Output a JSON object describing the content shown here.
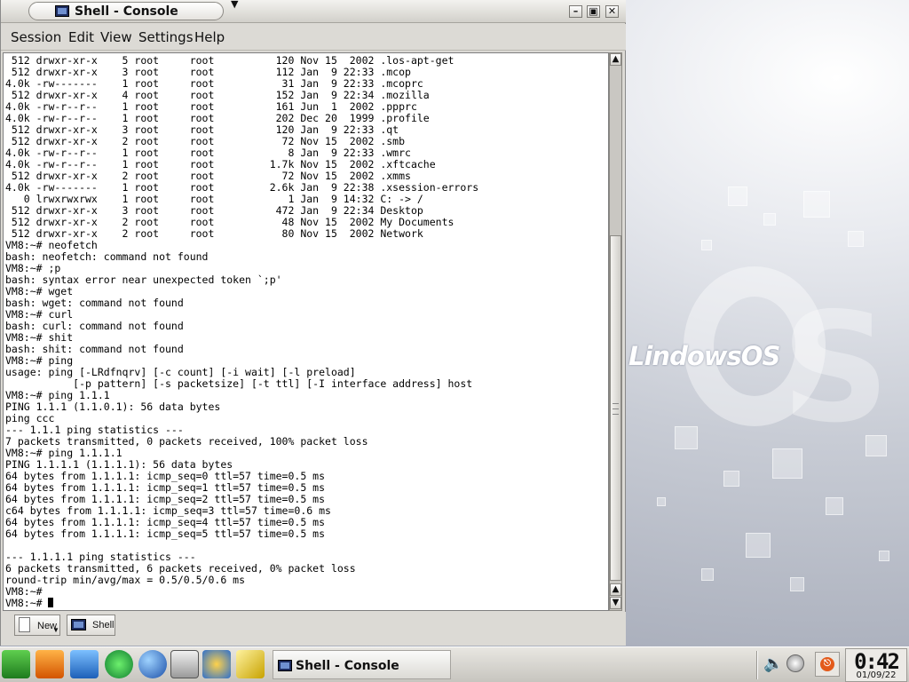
{
  "window": {
    "title": "Shell - Console"
  },
  "menubar": {
    "items": [
      "Session",
      "Edit",
      "View",
      "Settings",
      "Help"
    ]
  },
  "terminal": {
    "lines": [
      " 512 drwxr-xr-x    5 root     root          120 Nov 15  2002 .los-apt-get",
      " 512 drwxr-xr-x    3 root     root          112 Jan  9 22:33 .mcop",
      "4.0k -rw-------    1 root     root           31 Jan  9 22:33 .mcoprc",
      " 512 drwxr-xr-x    4 root     root          152 Jan  9 22:34 .mozilla",
      "4.0k -rw-r--r--    1 root     root          161 Jun  1  2002 .ppprc",
      "4.0k -rw-r--r--    1 root     root          202 Dec 20  1999 .profile",
      " 512 drwxr-xr-x    3 root     root          120 Jan  9 22:33 .qt",
      " 512 drwxr-xr-x    2 root     root           72 Nov 15  2002 .smb",
      "4.0k -rw-r--r--    1 root     root            8 Jan  9 22:33 .wmrc",
      "4.0k -rw-r--r--    1 root     root         1.7k Nov 15  2002 .xftcache",
      " 512 drwxr-xr-x    2 root     root           72 Nov 15  2002 .xmms",
      "4.0k -rw-------    1 root     root         2.6k Jan  9 22:38 .xsession-errors",
      "   0 lrwxrwxrwx    1 root     root            1 Jan  9 14:32 C: -> /",
      " 512 drwxr-xr-x    3 root     root          472 Jan  9 22:34 Desktop",
      " 512 drwxr-xr-x    2 root     root           48 Nov 15  2002 My Documents",
      " 512 drwxr-xr-x    2 root     root           80 Nov 15  2002 Network",
      "VM8:~# neofetch",
      "bash: neofetch: command not found",
      "VM8:~# ;p",
      "bash: syntax error near unexpected token `;p'",
      "VM8:~# wget",
      "bash: wget: command not found",
      "VM8:~# curl",
      "bash: curl: command not found",
      "VM8:~# shit",
      "bash: shit: command not found",
      "VM8:~# ping",
      "usage: ping [-LRdfnqrv] [-c count] [-i wait] [-l preload]",
      "           [-p pattern] [-s packetsize] [-t ttl] [-I interface address] host",
      "VM8:~# ping 1.1.1",
      "PING 1.1.1 (1.1.0.1): 56 data bytes",
      "ping ccc",
      "--- 1.1.1 ping statistics ---",
      "7 packets transmitted, 0 packets received, 100% packet loss",
      "VM8:~# ping 1.1.1.1",
      "PING 1.1.1.1 (1.1.1.1): 56 data bytes",
      "64 bytes from 1.1.1.1: icmp_seq=0 ttl=57 time=0.5 ms",
      "64 bytes from 1.1.1.1: icmp_seq=1 ttl=57 time=0.5 ms",
      "64 bytes from 1.1.1.1: icmp_seq=2 ttl=57 time=0.5 ms",
      "c64 bytes from 1.1.1.1: icmp_seq=3 ttl=57 time=0.6 ms",
      "64 bytes from 1.1.1.1: icmp_seq=4 ttl=57 time=0.5 ms",
      "64 bytes from 1.1.1.1: icmp_seq=5 ttl=57 time=0.5 ms",
      "",
      "--- 1.1.1.1 ping statistics ---",
      "6 packets transmitted, 6 packets received, 0% packet loss",
      "round-trip min/avg/max = 0.5/0.5/0.6 ms",
      "VM8:~#"
    ],
    "prompt": "VM8:~# "
  },
  "tabs": {
    "new_label": "New",
    "shell_label": "Shell"
  },
  "desktop": {
    "logo": "LindowsOS"
  },
  "panel": {
    "launchers": [
      "lindows-start-icon",
      "safety-icon",
      "box-icon",
      "runner-icon",
      "globe-icon",
      "terminal-icon",
      "click-n-run-icon",
      "office-icon"
    ],
    "task_label": "Shell - Console",
    "clock_time": "0:42",
    "clock_date": "01/09/22"
  },
  "colors": {
    "terminal_bg": "#ffffff",
    "terminal_fg": "#000000",
    "chrome": "#dcdad5"
  }
}
